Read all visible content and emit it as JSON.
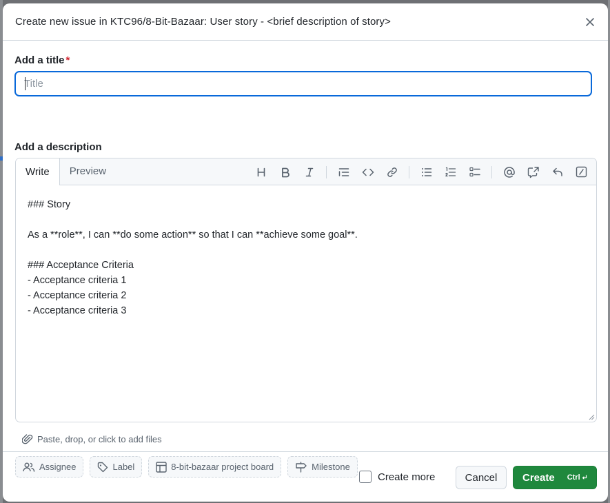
{
  "dialog": {
    "title": "Create new issue in KTC96/8-Bit-Bazaar: User story - <brief description of story>"
  },
  "form": {
    "title_label": "Add a title",
    "required_marker": "*",
    "title_placeholder": "Title",
    "title_value": "",
    "description_label": "Add a description"
  },
  "editor": {
    "tabs": [
      {
        "label": "Write",
        "active": true
      },
      {
        "label": "Preview",
        "active": false
      }
    ],
    "toolbar": [
      "heading-icon",
      "bold-icon",
      "italic-icon",
      "quote-icon",
      "code-icon",
      "link-icon",
      "unordered-list-icon",
      "ordered-list-icon",
      "task-list-icon",
      "mention-icon",
      "cross-reference-icon",
      "reply-icon",
      "slash-commands-icon"
    ],
    "body_text": "### Story\n\nAs a **role**, I can **do some action** so that I can **achieve some goal**.\n\n### Acceptance Criteria\n- Acceptance criteria 1\n- Acceptance criteria 2\n- Acceptance criteria 3"
  },
  "attachments": {
    "label": "Paste, drop, or click to add files"
  },
  "metadata": {
    "assignee": "Assignee",
    "label": "Label",
    "project": "8-bit-bazaar project board",
    "milestone": "Milestone"
  },
  "footer": {
    "create_more": "Create more",
    "create_more_checked": false,
    "cancel": "Cancel",
    "create": "Create",
    "shortcut": "Ctrl"
  },
  "colors": {
    "accent": "#0969da",
    "primary_button": "#1f883d",
    "required": "#d1242f"
  }
}
